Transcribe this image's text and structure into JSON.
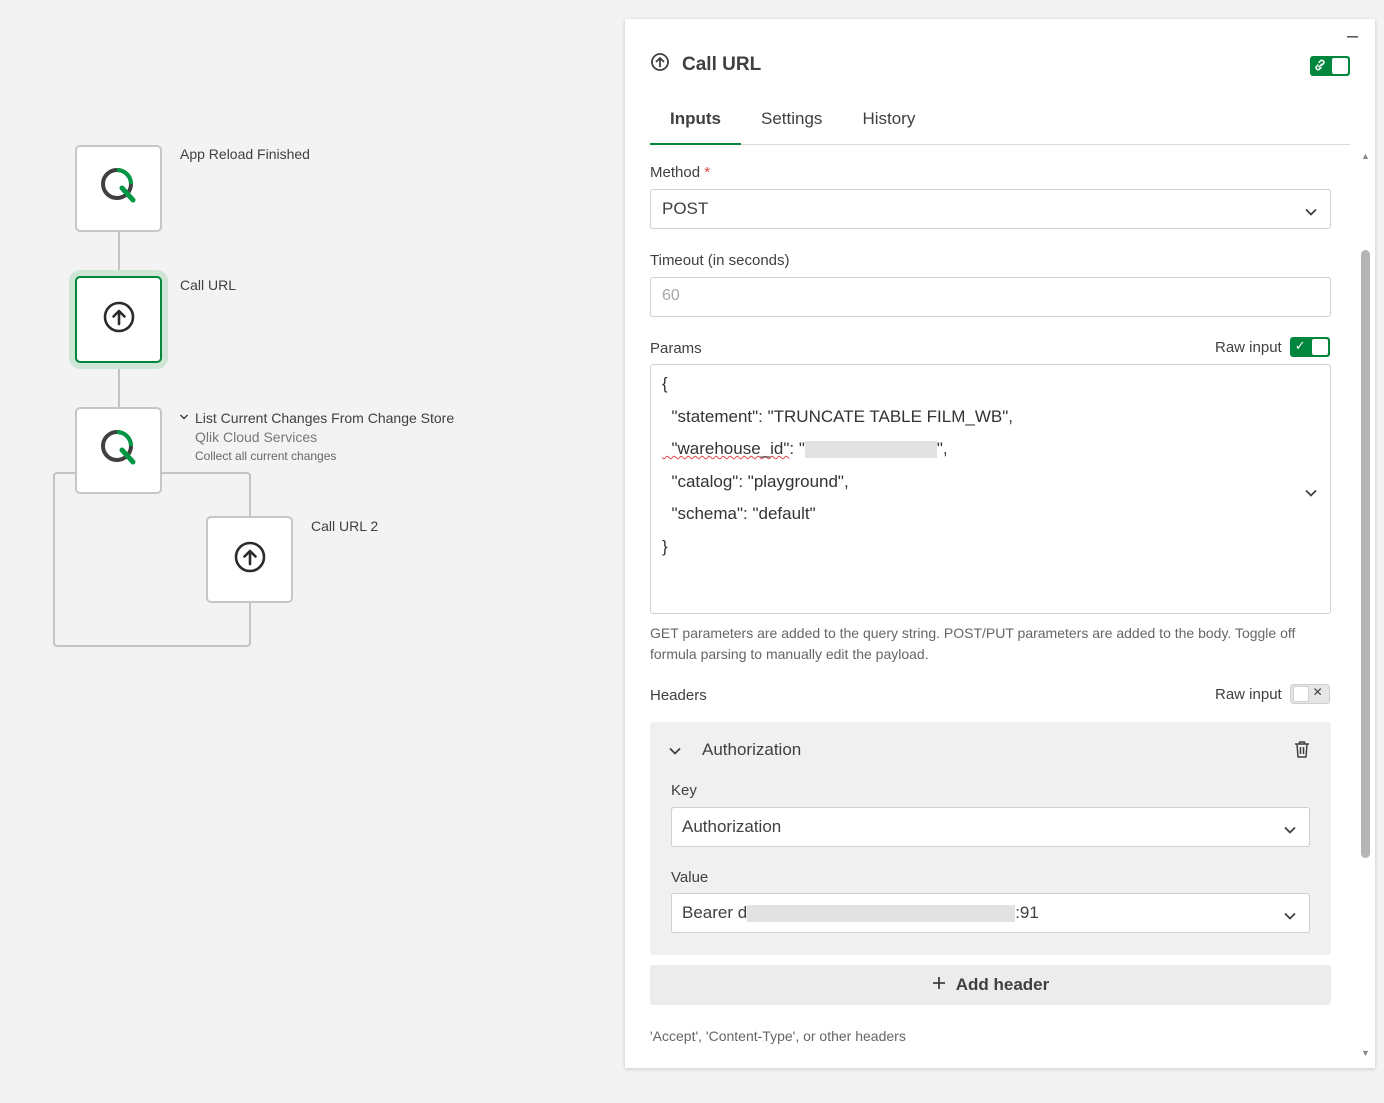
{
  "flow": {
    "nodes": [
      {
        "title": "App Reload Finished",
        "icon": "qlik-logo-icon"
      },
      {
        "title": "Call URL",
        "icon": "upload-circle-icon",
        "selected": true
      },
      {
        "title": "List Current Changes From Change Store",
        "subtitle": "Qlik Cloud Services",
        "description": "Collect all current changes",
        "icon": "qlik-logo-icon"
      },
      {
        "title": "Call URL 2",
        "icon": "upload-circle-icon"
      }
    ]
  },
  "panel": {
    "title": "Call URL",
    "tabs": [
      "Inputs",
      "Settings",
      "History"
    ],
    "active_tab": "Inputs",
    "method": {
      "label": "Method",
      "required_mark": "*",
      "value": "POST"
    },
    "timeout": {
      "label": "Timeout (in seconds)",
      "placeholder": "60"
    },
    "params": {
      "label": "Params",
      "raw_input_label": "Raw input",
      "raw_input_on": true,
      "lines": {
        "open": "{",
        "statement": "  \"statement\": \"TRUNCATE TABLE FILM_WB\",",
        "warehouse_key": "  \"warehouse_id\"",
        "warehouse_sep": ": \"",
        "warehouse_end": "\",",
        "catalog": "  \"catalog\": \"playground\",",
        "schema": "  \"schema\": \"default\"",
        "close": "}"
      },
      "help": "GET parameters are added to the query string. POST/PUT parameters are added to the body. Toggle off formula parsing to manually edit the payload."
    },
    "headers": {
      "label": "Headers",
      "raw_input_label": "Raw input",
      "raw_input_on": false,
      "items": [
        {
          "name": "Authorization",
          "key_label": "Key",
          "key_value": "Authorization",
          "value_label": "Value",
          "value_prefix": "Bearer d",
          "value_suffix": ":91"
        }
      ],
      "add_button": "Add header",
      "help": "'Accept', 'Content-Type', or other headers"
    }
  },
  "colors": {
    "accent": "#00873d",
    "required": "#e0454a"
  }
}
